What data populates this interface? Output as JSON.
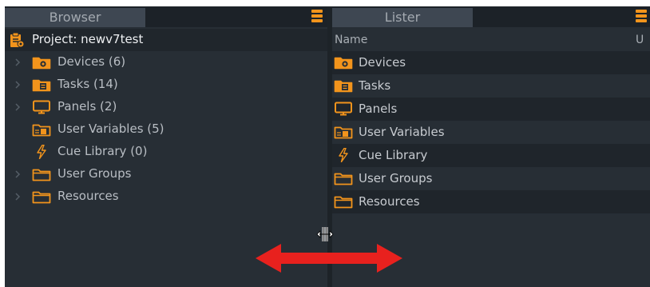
{
  "browser": {
    "tab_label": "Browser",
    "root_label": "Project: newv7test",
    "items": [
      {
        "label": "Devices (6)",
        "icon": "folder-gear-icon",
        "expandable": true
      },
      {
        "label": "Tasks (14)",
        "icon": "folder-task-icon",
        "expandable": true
      },
      {
        "label": "Panels (2)",
        "icon": "monitor-icon",
        "expandable": true
      },
      {
        "label": "User Variables (5)",
        "icon": "folder-variables-icon",
        "expandable": false
      },
      {
        "label": "Cue Library (0)",
        "icon": "lightning-icon",
        "expandable": false
      },
      {
        "label": "User Groups",
        "icon": "folder-icon",
        "expandable": true
      },
      {
        "label": "Resources",
        "icon": "folder-icon",
        "expandable": true
      }
    ]
  },
  "lister": {
    "tab_label": "Lister",
    "columns": [
      "Name",
      "U"
    ],
    "rows": [
      {
        "label": "Devices",
        "icon": "folder-gear-icon"
      },
      {
        "label": "Tasks",
        "icon": "folder-task-icon"
      },
      {
        "label": "Panels",
        "icon": "monitor-icon"
      },
      {
        "label": "User Variables",
        "icon": "folder-variables-icon"
      },
      {
        "label": "Cue Library",
        "icon": "lightning-icon"
      },
      {
        "label": "User Groups",
        "icon": "folder-icon"
      },
      {
        "label": "Resources",
        "icon": "folder-icon"
      }
    ]
  },
  "colors": {
    "accent": "#f2941c",
    "panel_bg": "#272e35",
    "arrow": "#e8211e"
  }
}
